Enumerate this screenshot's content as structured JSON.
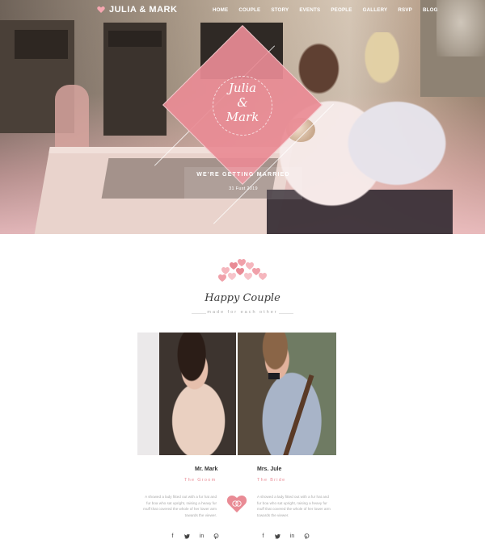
{
  "brand": {
    "name": "JULIA & MARK",
    "accent": "#e98b95"
  },
  "nav": {
    "items": [
      "HOME",
      "COUPLE",
      "STORY",
      "EVENTS",
      "PEOPLE",
      "GALLERY",
      "RSVP",
      "BLOG"
    ]
  },
  "hero": {
    "names_line1": "Julia",
    "names_amp": "&",
    "names_line2": "Mark",
    "tagline": "WE'RE GETTING MARRIED",
    "date": "31 Fust 2019"
  },
  "couple": {
    "title": "Happy Couple",
    "subtitle": "made for each other",
    "groom": {
      "name": "Mr. Mark",
      "role": "The Groom",
      "bio": "A showed a lady fitted out with a fur hat and fur boa who sat upright, raising a heavy fur muff that covered the whole of her lower arm towards the viewer."
    },
    "bride": {
      "name": "Mrs. Jule",
      "role": "The Bride",
      "bio": "A showed a lady fitted out with a fur hat and fur boa who sat upright, raising a heavy fur muff that covered the whole of her lower arm towards the viewer."
    },
    "social_icons": [
      "facebook-icon",
      "twitter-icon",
      "linkedin-icon",
      "pinterest-icon"
    ]
  }
}
